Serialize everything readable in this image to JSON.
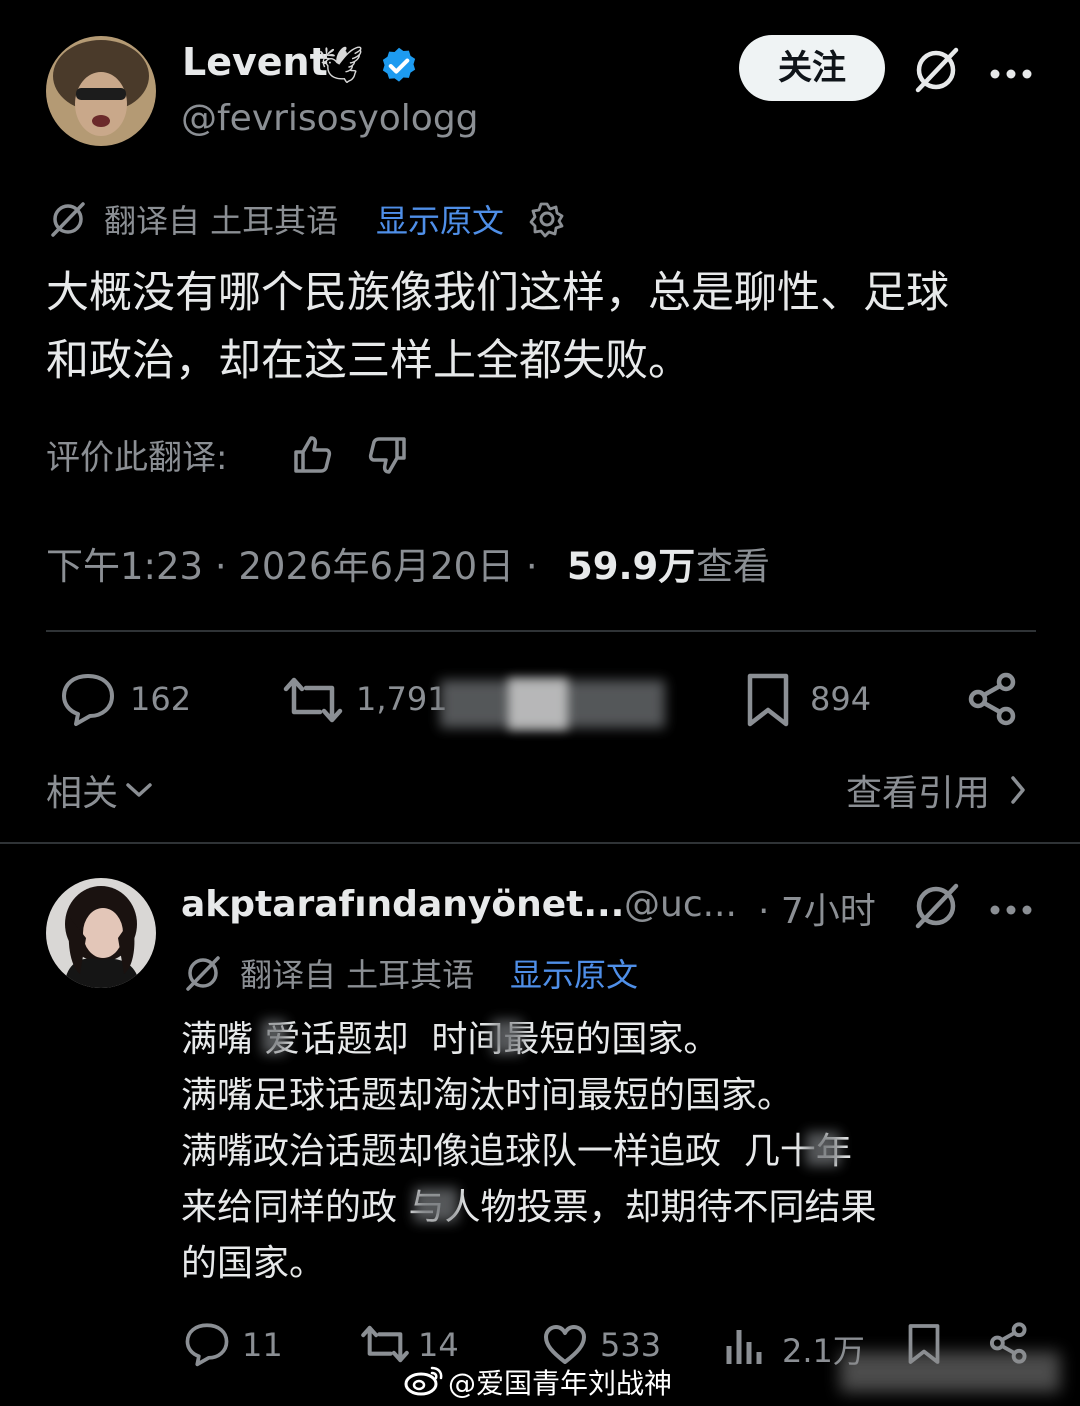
{
  "post": {
    "author": {
      "name": "Levent",
      "handle": "@fevrisosyologg",
      "verified": true,
      "verified_color": "#1d9bf0"
    },
    "follow_label": "关注",
    "translation": {
      "source_label": "翻译自 土耳其语",
      "show_original": "显示原文"
    },
    "text_line1": "大概没有哪个民族像我们这样，总是聊性、足球",
    "text_line2": "和政治，却在这三样上全都失败。",
    "rate_translation": "评价此翻译:",
    "meta": {
      "time_date": "下午1:23 · 2026年6月20日 ·",
      "views_count": "59.9万",
      "views_label": "查看"
    },
    "stats": {
      "replies": "162",
      "reposts": "1,791",
      "bookmarks": "894"
    },
    "related_label": "相关",
    "view_quotes_label": "查看引用"
  },
  "reply": {
    "author": {
      "name": "akptarafındanyönet...",
      "handle": "@uc...",
      "time": "· 7小时"
    },
    "translation": {
      "source_label": "翻译自 土耳其语",
      "show_original": "显示原文"
    },
    "lines": [
      "满嘴 爱话题却  时间最短的国家。",
      "满嘴足球话题却淘汰时间最短的国家。",
      "满嘴政治话题却像追球队一样追政  几十年",
      "来给同样的政 与人物投票，却期待不同结果",
      "的国家。"
    ],
    "stats": {
      "replies": "11",
      "reposts": "14",
      "likes": "533",
      "views": "2.1万"
    }
  },
  "watermark": "@爱国青年刘战神",
  "colors": {
    "background": "#000000",
    "text": "#e7e9ea",
    "muted": "#8b8f94",
    "link": "#4f8fe8"
  }
}
